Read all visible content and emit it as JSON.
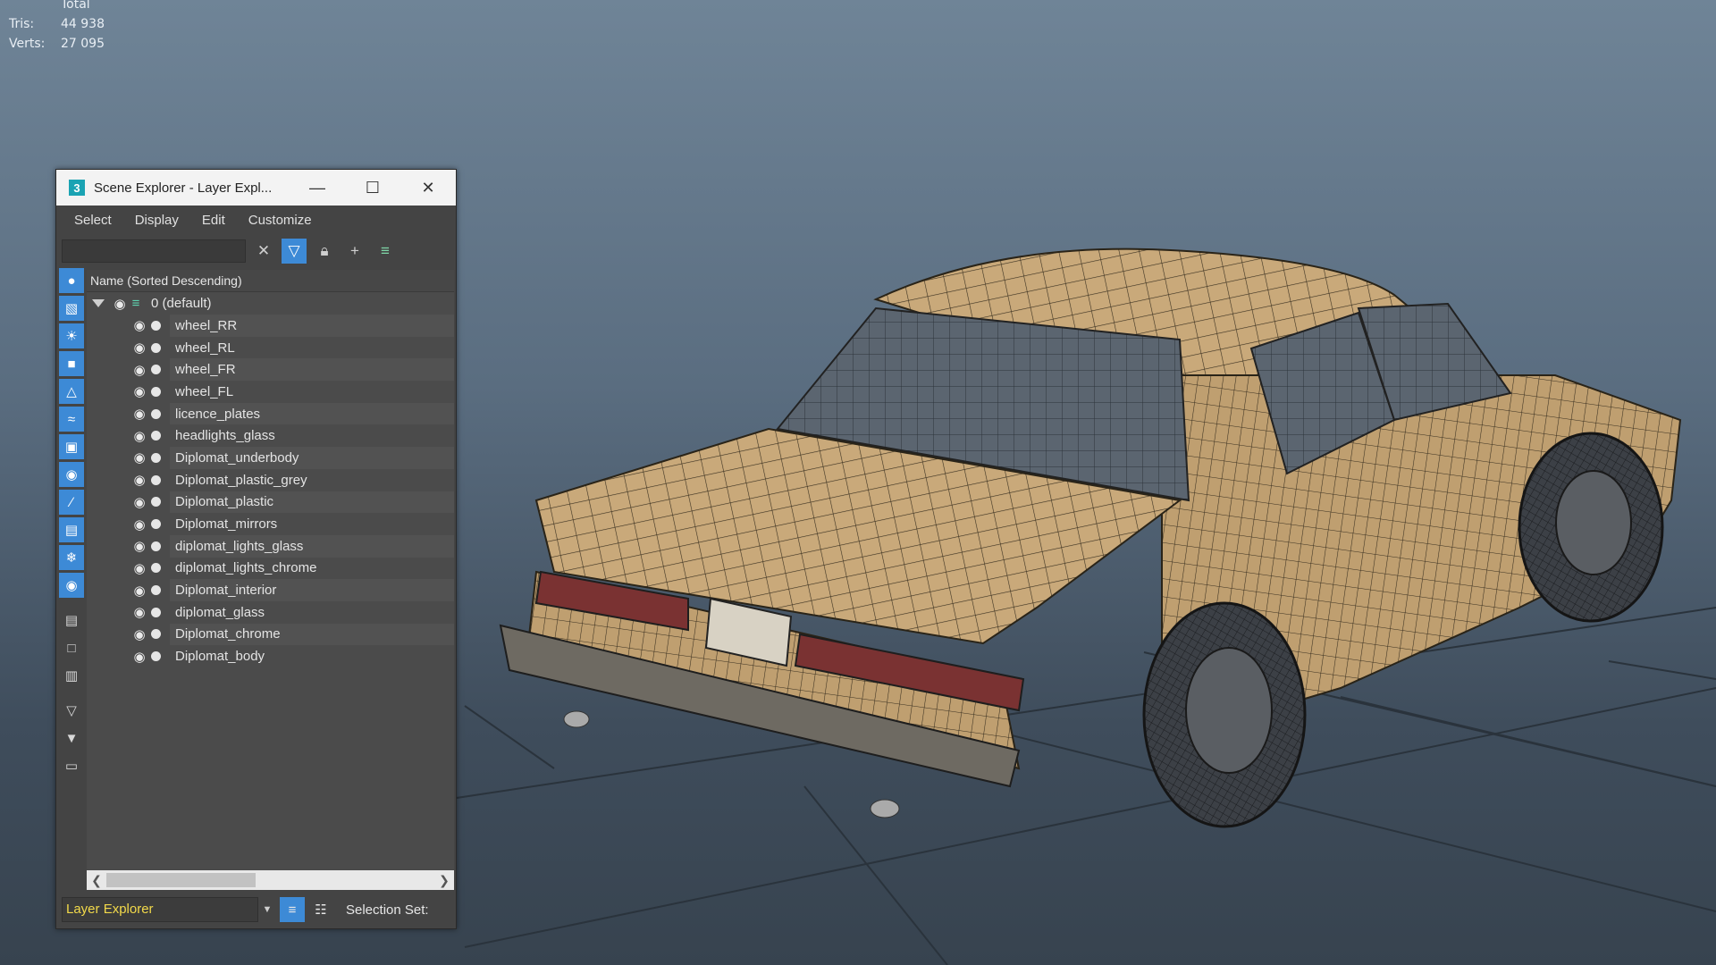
{
  "stats": {
    "header": "Total",
    "tris_label": "Tris:",
    "tris_value": "44 938",
    "verts_label": "Verts:",
    "verts_value": "27 095"
  },
  "window": {
    "title": "Scene Explorer - Layer Expl...",
    "app_icon": "3",
    "minimize_icon": "minimize-icon",
    "maximize_icon": "maximize-icon",
    "close_icon": "close-icon"
  },
  "menu": [
    "Select",
    "Display",
    "Edit",
    "Customize"
  ],
  "toolbar": {
    "search_value": "",
    "icons": [
      "clear-icon",
      "filter-icon",
      "lock-icon",
      "add-layer-icon",
      "layers-icon"
    ]
  },
  "list": {
    "header": "Name (Sorted Descending)",
    "layer_name": "0 (default)",
    "objects": [
      "wheel_RR",
      "wheel_RL",
      "wheel_FR",
      "wheel_FL",
      "licence_plates",
      "headlights_glass",
      "Diplomat_underbody",
      "Diplomat_plastic_grey",
      "Diplomat_plastic",
      "Diplomat_mirrors",
      "diplomat_lights_glass",
      "diplomat_lights_chrome",
      "Diplomat_interior",
      "diplomat_glass",
      "Diplomat_chrome",
      "Diplomat_body"
    ]
  },
  "bottom": {
    "explorer_mode": "Layer Explorer",
    "selection_set_label": "Selection Set:"
  },
  "colors": {
    "accent": "#3d8ad6",
    "mode_text": "#f2d94a",
    "car_body": "#c8a878",
    "wire": "#2a2418"
  }
}
